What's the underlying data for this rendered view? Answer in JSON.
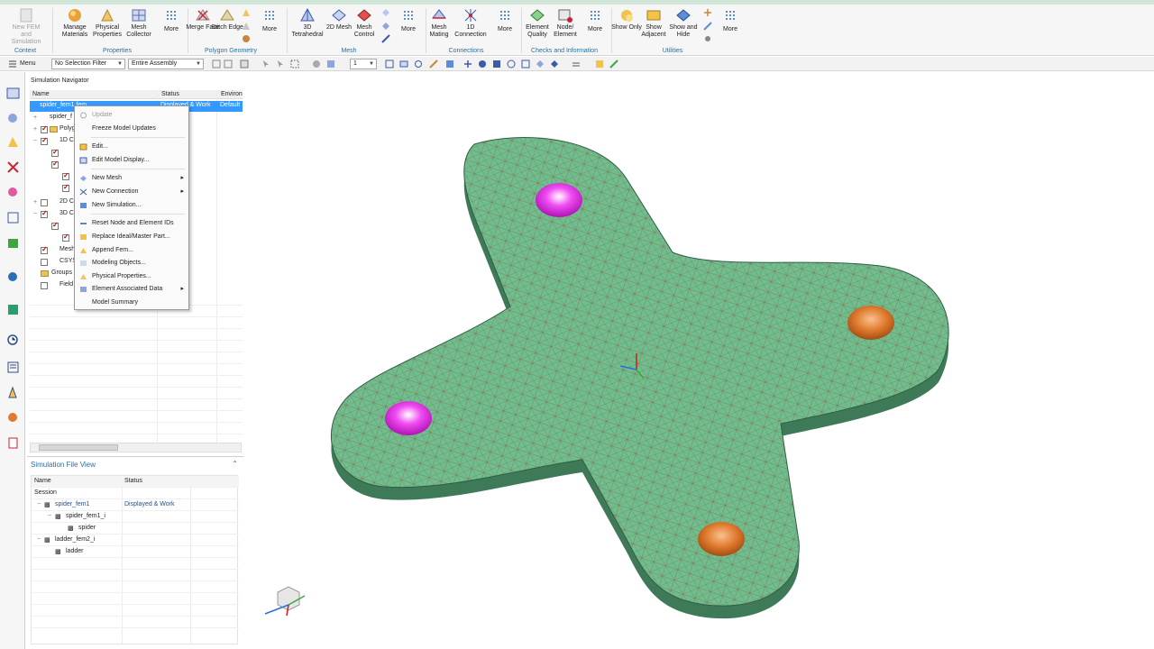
{
  "ribbon": {
    "buttons": [
      {
        "label": "New FEM and Simulation",
        "enabled": false
      },
      {
        "label": "Manage Materials"
      },
      {
        "label": "Physical Properties"
      },
      {
        "label": "Mesh Collector"
      },
      {
        "label": "More"
      },
      {
        "label": "Merge Face"
      },
      {
        "label": "Stitch Edge"
      },
      {
        "label": "More"
      },
      {
        "label": "3D Tetrahedral"
      },
      {
        "label": "2D Mesh"
      },
      {
        "label": "Mesh Control"
      },
      {
        "label": "More"
      },
      {
        "label": "Mesh Mating"
      },
      {
        "label": "1D Connection"
      },
      {
        "label": "More"
      },
      {
        "label": "Element Quality"
      },
      {
        "label": "Node/ Element"
      },
      {
        "label": "More"
      },
      {
        "label": "Show Only"
      },
      {
        "label": "Show Adjacent"
      },
      {
        "label": "Show and Hide"
      },
      {
        "label": "More"
      }
    ],
    "groups": [
      "Context",
      "Properties",
      "Polygon Geometry",
      "Mesh",
      "Connections",
      "Checks and Information",
      "Utilities"
    ]
  },
  "toolbar": {
    "menu_label": "Menu",
    "selection_filter": "No Selection Filter",
    "assembly_scope": "Entire Assembly",
    "number_field": "1"
  },
  "navigator": {
    "title": "Simulation Navigator",
    "columns": [
      "Name",
      "Status",
      "Environ"
    ],
    "selected": {
      "name": "spider_fem1.fem",
      "status": "Displayed & Work",
      "env": "Default"
    },
    "rows": [
      "spider_f",
      "Polyg",
      "1D C",
      "",
      "",
      "",
      "",
      "",
      "2D C",
      "3D C",
      "",
      "",
      "Mesh",
      "CSYS",
      "Groups",
      "Field"
    ]
  },
  "context_menu": {
    "items": [
      {
        "label": "Update",
        "enabled": false,
        "icon": "update-icon"
      },
      {
        "label": "Freeze Model Updates",
        "icon": "none"
      },
      {
        "label": "Edit...",
        "icon": "edit-icon"
      },
      {
        "label": "Edit Model Display...",
        "icon": "display-icon"
      },
      {
        "label": "New Mesh",
        "submenu": true,
        "icon": "mesh-icon"
      },
      {
        "label": "New Connection",
        "submenu": true,
        "icon": "connection-icon"
      },
      {
        "label": "New Simulation...",
        "icon": "simulation-icon"
      },
      {
        "label": "Reset Node and Element IDs",
        "icon": "reset-icon"
      },
      {
        "label": "Replace Ideal/Master Part...",
        "icon": "replace-icon"
      },
      {
        "label": "Append Fem...",
        "icon": "append-icon"
      },
      {
        "label": "Modeling Objects...",
        "icon": "modeling-icon"
      },
      {
        "label": "Physical Properties...",
        "icon": "physical-icon"
      },
      {
        "label": "Element Associated Data",
        "submenu": true,
        "icon": "element-data-icon"
      },
      {
        "label": "Model Summary",
        "icon": "summary-icon"
      }
    ]
  },
  "file_view": {
    "title": "Simulation File View",
    "columns": [
      "Name",
      "Status"
    ],
    "rows": [
      {
        "name": "Session",
        "status": "",
        "indent": 0
      },
      {
        "name": "spider_fem1",
        "status": "Displayed & Work",
        "indent": 1
      },
      {
        "name": "spider_fem1_i",
        "status": "",
        "indent": 2
      },
      {
        "name": "spider",
        "status": "",
        "indent": 3
      },
      {
        "name": "ladder_fem2_i",
        "status": "",
        "indent": 1
      },
      {
        "name": "ladder",
        "status": "",
        "indent": 2
      }
    ]
  },
  "colors": {
    "mesh": "#6fbf8e",
    "mesh_lines": "#8b3a2e",
    "hole_magenta": "#e11ee6",
    "hole_orange": "#e07a2e",
    "selection": "#3399ff",
    "accent": "#2a6f9e"
  }
}
